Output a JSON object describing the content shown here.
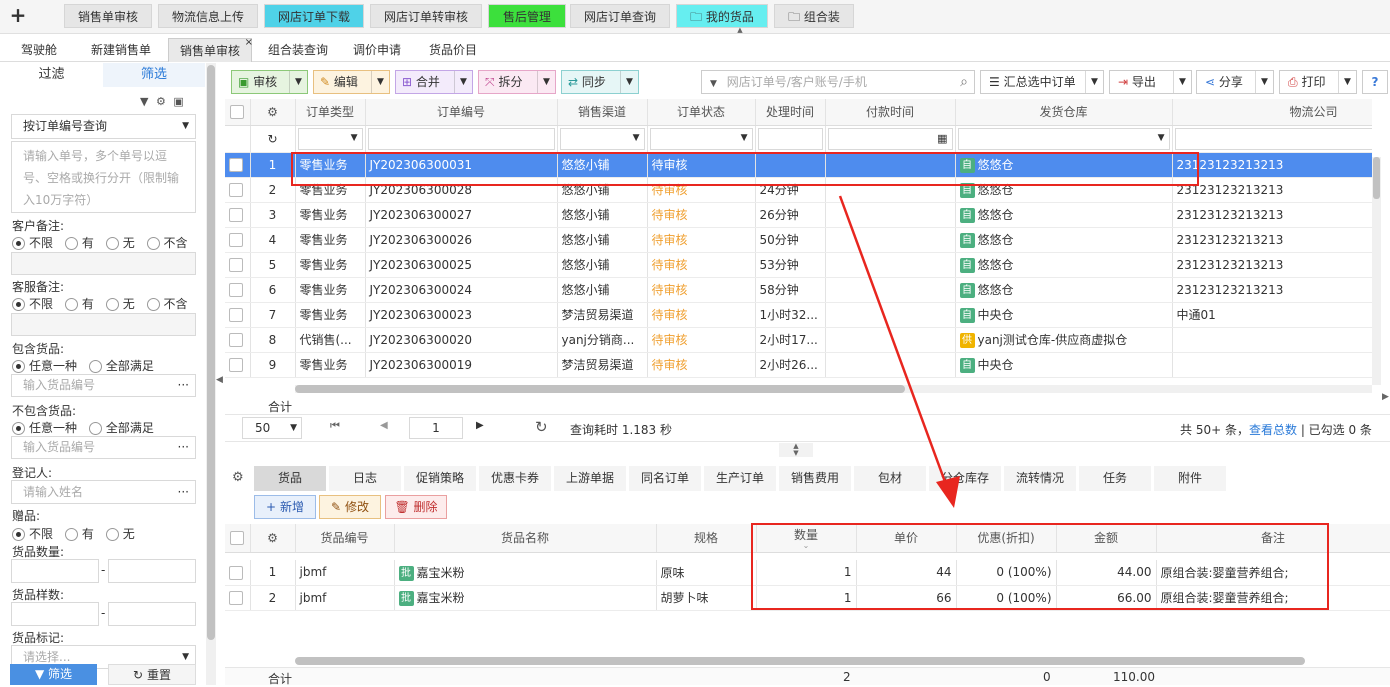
{
  "top_tabs": [
    {
      "label": "销售单审核",
      "bg": "#e6e6e6"
    },
    {
      "label": "物流信息上传",
      "bg": "#e6e6e6"
    },
    {
      "label": "网店订单下载",
      "bg": "#4fd2e8"
    },
    {
      "label": "网店订单转审核",
      "bg": "#e6e6e6"
    },
    {
      "label": "售后管理",
      "bg": "#3ce03c"
    },
    {
      "label": "网店订单查询",
      "bg": "#e6e6e6"
    },
    {
      "label": "我的货品",
      "bg": "#66eef0"
    },
    {
      "label": "组合装",
      "bg": "#e6e6e6"
    }
  ],
  "sub_tabs": [
    "驾驶舱",
    "新建销售单",
    "销售单审核",
    "组合装查询",
    "调价申请",
    "货品价目"
  ],
  "sidebar": {
    "tab_filter": "过滤",
    "tab_select": "筛选",
    "query_mode": "按订单编号查询",
    "order_input_placeholder": "请输入单号，多个单号以逗号、空格或换行分开（限制输入10万字符）",
    "customer_note": "客户备注:",
    "service_note": "客服备注:",
    "opt_unlimited": "不限",
    "opt_has": "有",
    "opt_none": "无",
    "opt_exclude": "不含",
    "include_goods": "包含货品:",
    "any_one": "任意一种",
    "all_meet": "全部满足",
    "goods_code_placeholder": "输入货品编号",
    "exclude_goods": "不包含货品:",
    "registrant": "登记人:",
    "name_placeholder": "请输入姓名",
    "gift": "赠品:",
    "goods_qty": "货品数量:",
    "goods_kinds": "货品样数:",
    "goods_mark": "货品标记:",
    "select_placeholder": "请选择...",
    "dash": "-",
    "btn_filter": "筛选",
    "btn_reset": "重置"
  },
  "toolbar": {
    "audit": "审核",
    "edit": "编辑",
    "merge": "合并",
    "split": "拆分",
    "sync": "同步",
    "search_placeholder": "网店订单号/客户账号/手机",
    "summary": "汇总选中订单",
    "export": "导出",
    "share": "分享",
    "print": "打印",
    "help": "?"
  },
  "order_columns": [
    "订单类型",
    "订单编号",
    "销售渠道",
    "订单状态",
    "处理时间",
    "付款时间",
    "发货仓库",
    "物流公司"
  ],
  "orders": [
    {
      "n": "1",
      "type": "零售业务",
      "no": "JY202306300031",
      "channel": "悠悠小铺",
      "status": "待审核",
      "proc": "",
      "wh_tag": "自",
      "wh": "悠悠仓",
      "logi": "23123123213213"
    },
    {
      "n": "2",
      "type": "零售业务",
      "no": "JY202306300028",
      "channel": "悠悠小铺",
      "status": "待审核",
      "proc": "24分钟",
      "wh_tag": "自",
      "wh": "悠悠仓",
      "logi": "23123123213213"
    },
    {
      "n": "3",
      "type": "零售业务",
      "no": "JY202306300027",
      "channel": "悠悠小铺",
      "status": "待审核",
      "proc": "26分钟",
      "wh_tag": "自",
      "wh": "悠悠仓",
      "logi": "23123123213213"
    },
    {
      "n": "4",
      "type": "零售业务",
      "no": "JY202306300026",
      "channel": "悠悠小铺",
      "status": "待审核",
      "proc": "50分钟",
      "wh_tag": "自",
      "wh": "悠悠仓",
      "logi": "23123123213213"
    },
    {
      "n": "5",
      "type": "零售业务",
      "no": "JY202306300025",
      "channel": "悠悠小铺",
      "status": "待审核",
      "proc": "53分钟",
      "wh_tag": "自",
      "wh": "悠悠仓",
      "logi": "23123123213213"
    },
    {
      "n": "6",
      "type": "零售业务",
      "no": "JY202306300024",
      "channel": "悠悠小铺",
      "status": "待审核",
      "proc": "58分钟",
      "wh_tag": "自",
      "wh": "悠悠仓",
      "logi": "23123123213213"
    },
    {
      "n": "7",
      "type": "零售业务",
      "no": "JY202306300023",
      "channel": "梦洁贸易渠道",
      "status": "待审核",
      "proc": "1小时32...",
      "wh_tag": "自",
      "wh": "中央仓",
      "logi": "中通01"
    },
    {
      "n": "8",
      "type": "代销售(...",
      "no": "JY202306300020",
      "channel": "yanj分销商...",
      "status": "待审核",
      "proc": "2小时17...",
      "wh_tag": "供",
      "wh": "yanj测试仓库-供应商虚拟仓",
      "logi": ""
    },
    {
      "n": "9",
      "type": "零售业务",
      "no": "JY202306300019",
      "channel": "梦洁贸易渠道",
      "status": "待审核",
      "proc": "2小时26...",
      "wh_tag": "自",
      "wh": "中央仓",
      "logi": ""
    }
  ],
  "total_label": "合计",
  "pager": {
    "page_size": "50",
    "page": "1",
    "query_time": "查询耗时 1.183 秒",
    "total": "共 50+ 条，",
    "view_total": "查看总数",
    "checked": "| 已勾选 0 条"
  },
  "detail_tabs": [
    "货品",
    "日志",
    "促销策略",
    "优惠卡券",
    "上游单据",
    "同名订单",
    "生产订单",
    "销售费用",
    "包材",
    "分仓库存",
    "流转情况",
    "任务",
    "附件"
  ],
  "detail_buttons": {
    "add": "新增",
    "modify": "修改",
    "delete": "删除"
  },
  "goods_columns": [
    "货品编号",
    "货品名称",
    "规格",
    "数量",
    "单价",
    "优惠(折扣)",
    "金额",
    "备注"
  ],
  "goods": [
    {
      "n": "1",
      "code": "jbmf",
      "tag": "批",
      "name": "嘉宝米粉",
      "spec": "原味",
      "qty": "1",
      "price": "44",
      "disc": "0 (100%)",
      "amount": "44.00",
      "note": "原组合装:婴童营养组合;"
    },
    {
      "n": "2",
      "code": "jbmf",
      "tag": "批",
      "name": "嘉宝米粉",
      "spec": "胡萝卜味",
      "qty": "1",
      "price": "66",
      "disc": "0 (100%)",
      "amount": "66.00",
      "note": "原组合装:婴童营养组合;"
    }
  ],
  "goods_total": {
    "label": "合计",
    "qty": "2",
    "disc": "0",
    "amount": "110.00"
  }
}
